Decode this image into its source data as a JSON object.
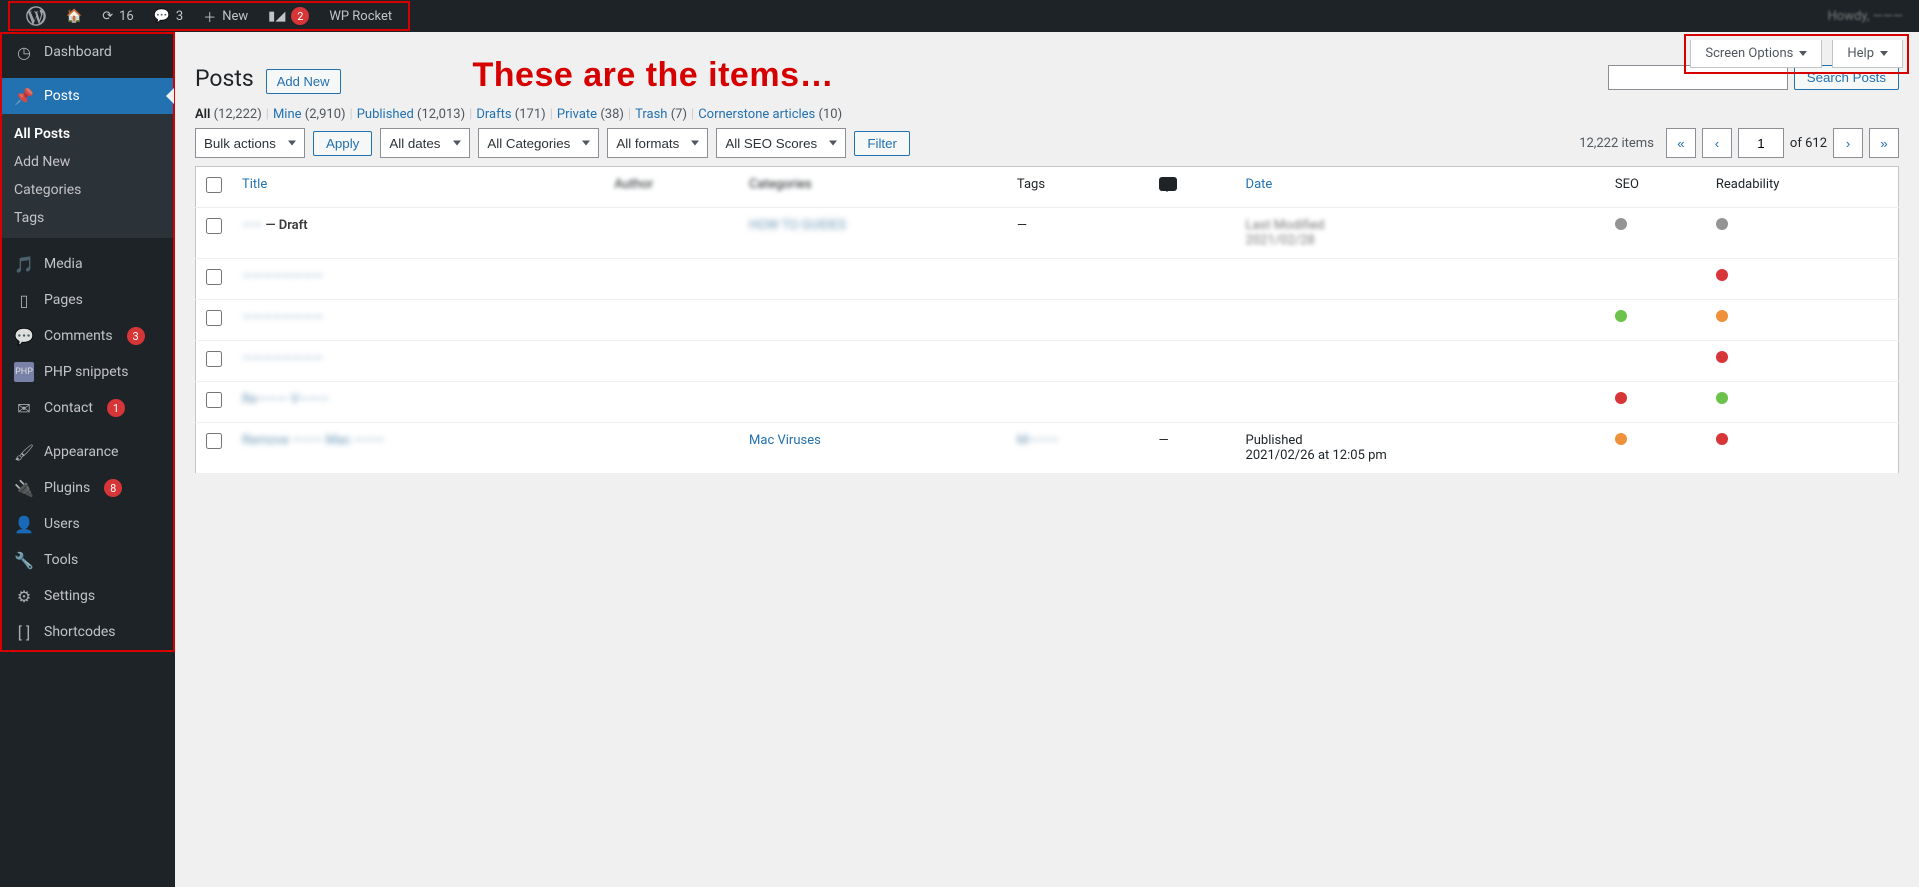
{
  "adminbar": {
    "updates": "16",
    "comments": "3",
    "new": "New",
    "yoast_badge": "2",
    "wp_rocket": "WP Rocket",
    "howdy": "Howdy, ———"
  },
  "sidebar": {
    "dashboard": "Dashboard",
    "posts": "Posts",
    "submenu": {
      "all": "All Posts",
      "add_new": "Add New",
      "categories": "Categories",
      "tags": "Tags"
    },
    "media": "Media",
    "pages": "Pages",
    "comments": "Comments",
    "comments_badge": "3",
    "php_snippets": "PHP snippets",
    "contact": "Contact",
    "contact_badge": "1",
    "appearance": "Appearance",
    "plugins": "Plugins",
    "plugins_badge": "8",
    "users": "Users",
    "tools": "Tools",
    "settings": "Settings",
    "shortcodes": "Shortcodes"
  },
  "screen_meta": {
    "screen_options": "Screen Options",
    "help": "Help"
  },
  "heading": {
    "title": "Posts",
    "add_new": "Add New"
  },
  "annotation": "These are the items…",
  "search": {
    "placeholder": "",
    "button": "Search Posts"
  },
  "filter_links": [
    {
      "label": "All",
      "count": "(12,222)",
      "current": true
    },
    {
      "label": "Mine",
      "count": "(2,910)"
    },
    {
      "label": "Published",
      "count": "(12,013)"
    },
    {
      "label": "Drafts",
      "count": "(171)"
    },
    {
      "label": "Private",
      "count": "(38)"
    },
    {
      "label": "Trash",
      "count": "(7)"
    },
    {
      "label": "Cornerstone articles",
      "count": "(10)"
    }
  ],
  "tablenav": {
    "bulk": "Bulk actions",
    "apply": "Apply",
    "all_dates": "All dates",
    "all_categories": "All Categories",
    "all_formats": "All formats",
    "all_seo": "All SEO Scores",
    "filter": "Filter",
    "items_label": "12,222 items",
    "first": "«",
    "prev": "‹",
    "current_page": "1",
    "of_pages": "of 612",
    "next": "›",
    "last": "»"
  },
  "columns": {
    "title": "Title",
    "author": "Author",
    "categories": "Categories",
    "tags": "Tags",
    "comments": "",
    "date": "Date",
    "seo": "SEO",
    "readability": "Readability"
  },
  "rows": [
    {
      "title_blur": "——",
      "title_suffix": " — Draft",
      "cat_blur": "HOW TO GUIDES",
      "tags": "—",
      "date1": "Last Modified",
      "date2": "2021/02/28",
      "seo": "gray",
      "read": "gray"
    },
    {
      "title_blur": "————————",
      "date1": "",
      "date2": "",
      "seo": "",
      "read": "red"
    },
    {
      "title_blur": "————————",
      "seo": "green",
      "read": "orange"
    },
    {
      "title_blur": "————————",
      "seo": "",
      "read": "red"
    },
    {
      "title_blur": "Re———  V———",
      "seo": "red",
      "read": "green"
    },
    {
      "title_blur": "Remove ——— Mac ———",
      "cat": "Mac Viruses",
      "tags": "M———",
      "comments_dash": "—",
      "date1": "Published",
      "date2": "2021/02/26 at 12:05 pm",
      "seo": "orange",
      "read": "red"
    }
  ]
}
